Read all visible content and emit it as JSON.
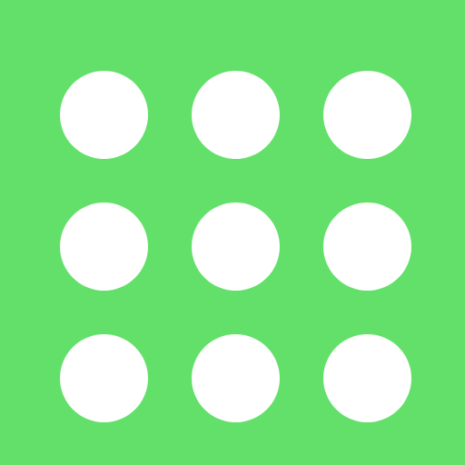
{
  "app_icon": {
    "icon": "dot-grid-icon",
    "background_color": "#63E06A",
    "dot_color": "#FFFFFF",
    "rows": 3,
    "columns": 3
  }
}
